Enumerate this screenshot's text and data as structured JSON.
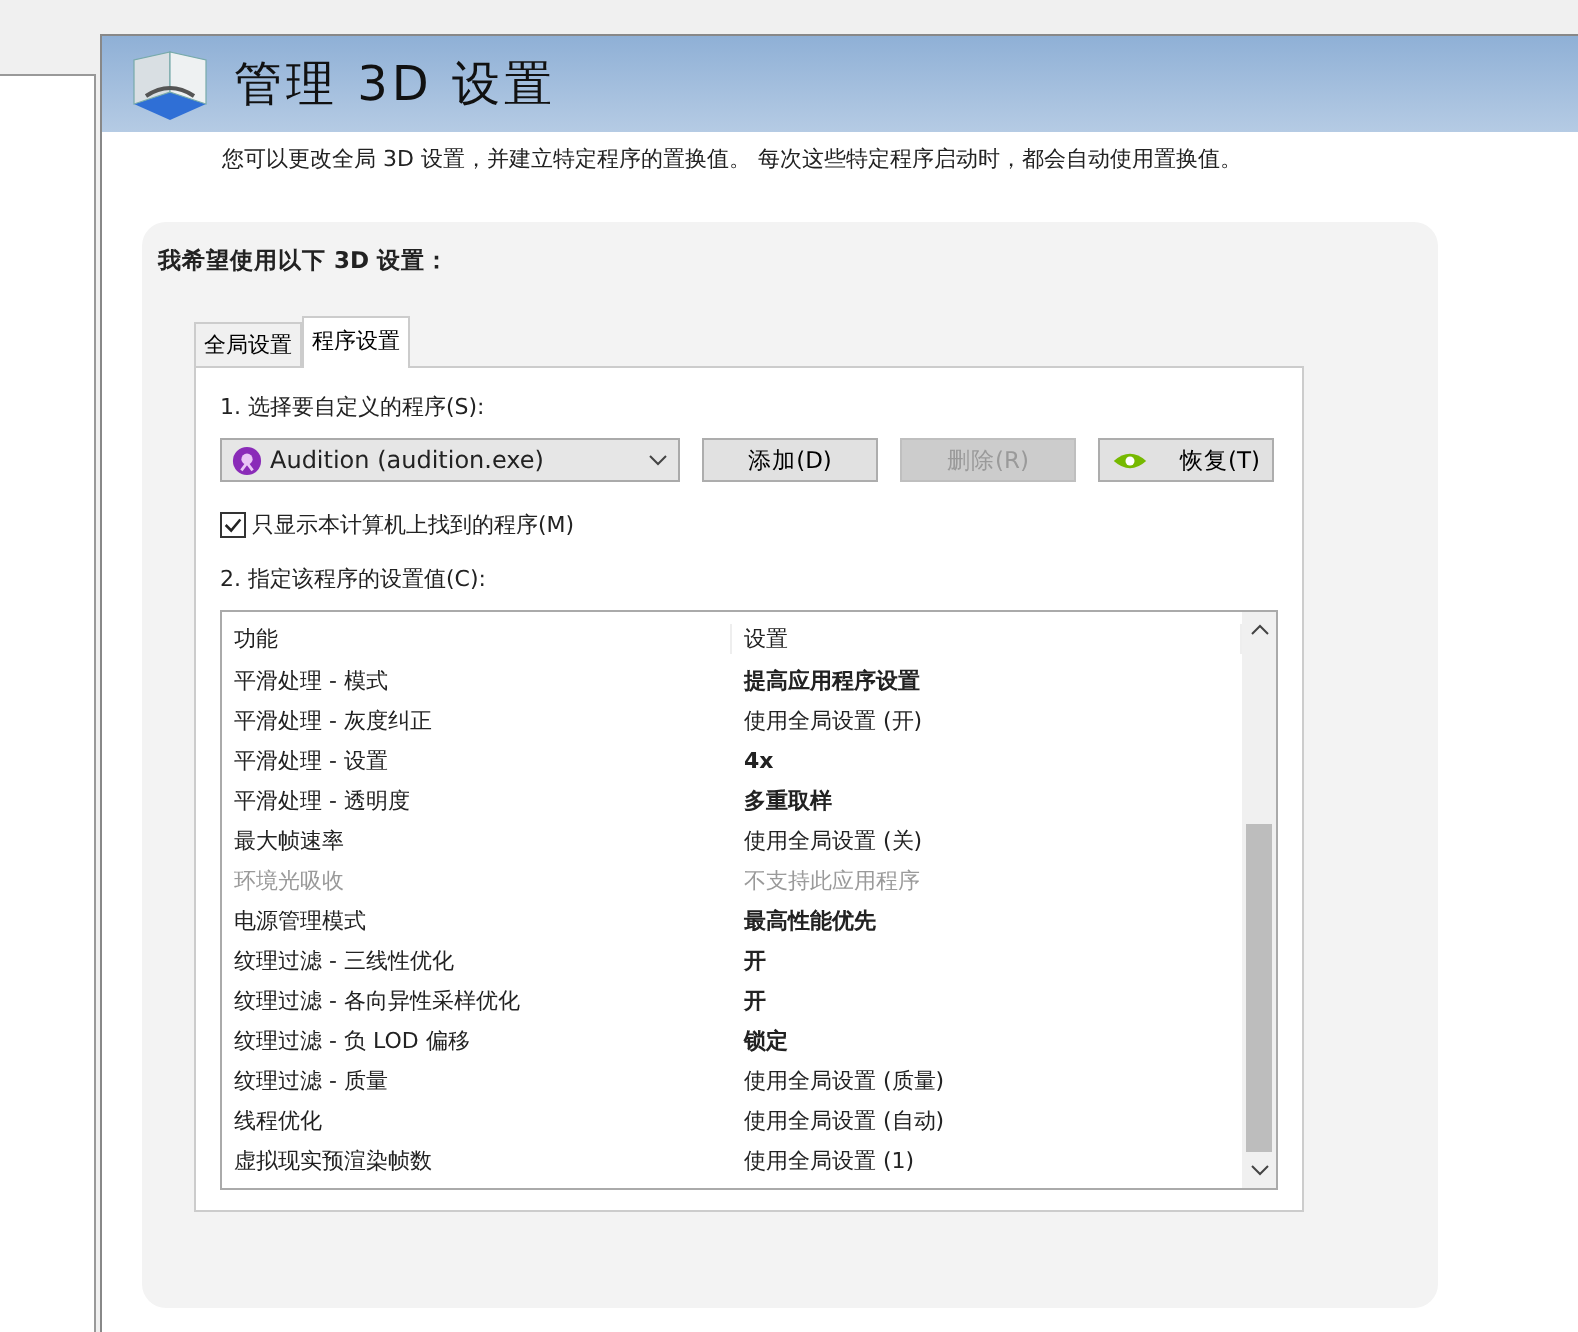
{
  "header": {
    "title": "管理 3D 设置"
  },
  "description": "您可以更改全局 3D 设置，并建立特定程序的置换值。 每次这些特定程序启动时，都会自动使用置换值。",
  "section_title": "我希望使用以下 3D 设置：",
  "tabs": [
    {
      "label": "全局设置",
      "selected": false
    },
    {
      "label": "程序设置",
      "selected": true
    }
  ],
  "step_1_label": "1. 选择要自定义的程序(S):",
  "program_select": {
    "value": "Audition (audition.exe)"
  },
  "buttons": [
    {
      "label": "添加(D)",
      "disabled": false,
      "kind": "plain"
    },
    {
      "label": "删除(R)",
      "disabled": true,
      "kind": "plain"
    },
    {
      "label": "恢复(T)",
      "disabled": false,
      "kind": "restore"
    }
  ],
  "only_local_checkbox": {
    "label": "只显示本计算机上找到的程序(M)",
    "checked": true
  },
  "step_2_label": "2. 指定该程序的设置值(C):",
  "table": {
    "columns": [
      "功能",
      "设置"
    ],
    "rows": [
      {
        "feature": "平滑处理 - 模式",
        "setting": "提高应用程序设置",
        "emphasized": true,
        "disabled": false
      },
      {
        "feature": "平滑处理 - 灰度纠正",
        "setting": "使用全局设置 (开)",
        "emphasized": false,
        "disabled": false
      },
      {
        "feature": "平滑处理 - 设置",
        "setting": "4x",
        "emphasized": true,
        "disabled": false
      },
      {
        "feature": "平滑处理 - 透明度",
        "setting": "多重取样",
        "emphasized": true,
        "disabled": false
      },
      {
        "feature": "最大帧速率",
        "setting": "使用全局设置 (关)",
        "emphasized": false,
        "disabled": false
      },
      {
        "feature": "环境光吸收",
        "setting": "不支持此应用程序",
        "emphasized": false,
        "disabled": true
      },
      {
        "feature": "电源管理模式",
        "setting": "最高性能优先",
        "emphasized": true,
        "disabled": false
      },
      {
        "feature": "纹理过滤 - 三线性优化",
        "setting": "开",
        "emphasized": true,
        "disabled": false
      },
      {
        "feature": "纹理过滤 - 各向异性采样优化",
        "setting": "开",
        "emphasized": true,
        "disabled": false
      },
      {
        "feature": "纹理过滤 - 负 LOD 偏移",
        "setting": "锁定",
        "emphasized": true,
        "disabled": false
      },
      {
        "feature": "纹理过滤 - 质量",
        "setting": "使用全局设置 (质量)",
        "emphasized": false,
        "disabled": false
      },
      {
        "feature": "线程优化",
        "setting": "使用全局设置 (自动)",
        "emphasized": false,
        "disabled": false
      },
      {
        "feature": "虚拟现实预渲染帧数",
        "setting": "使用全局设置 (1)",
        "emphasized": false,
        "disabled": false
      }
    ]
  }
}
